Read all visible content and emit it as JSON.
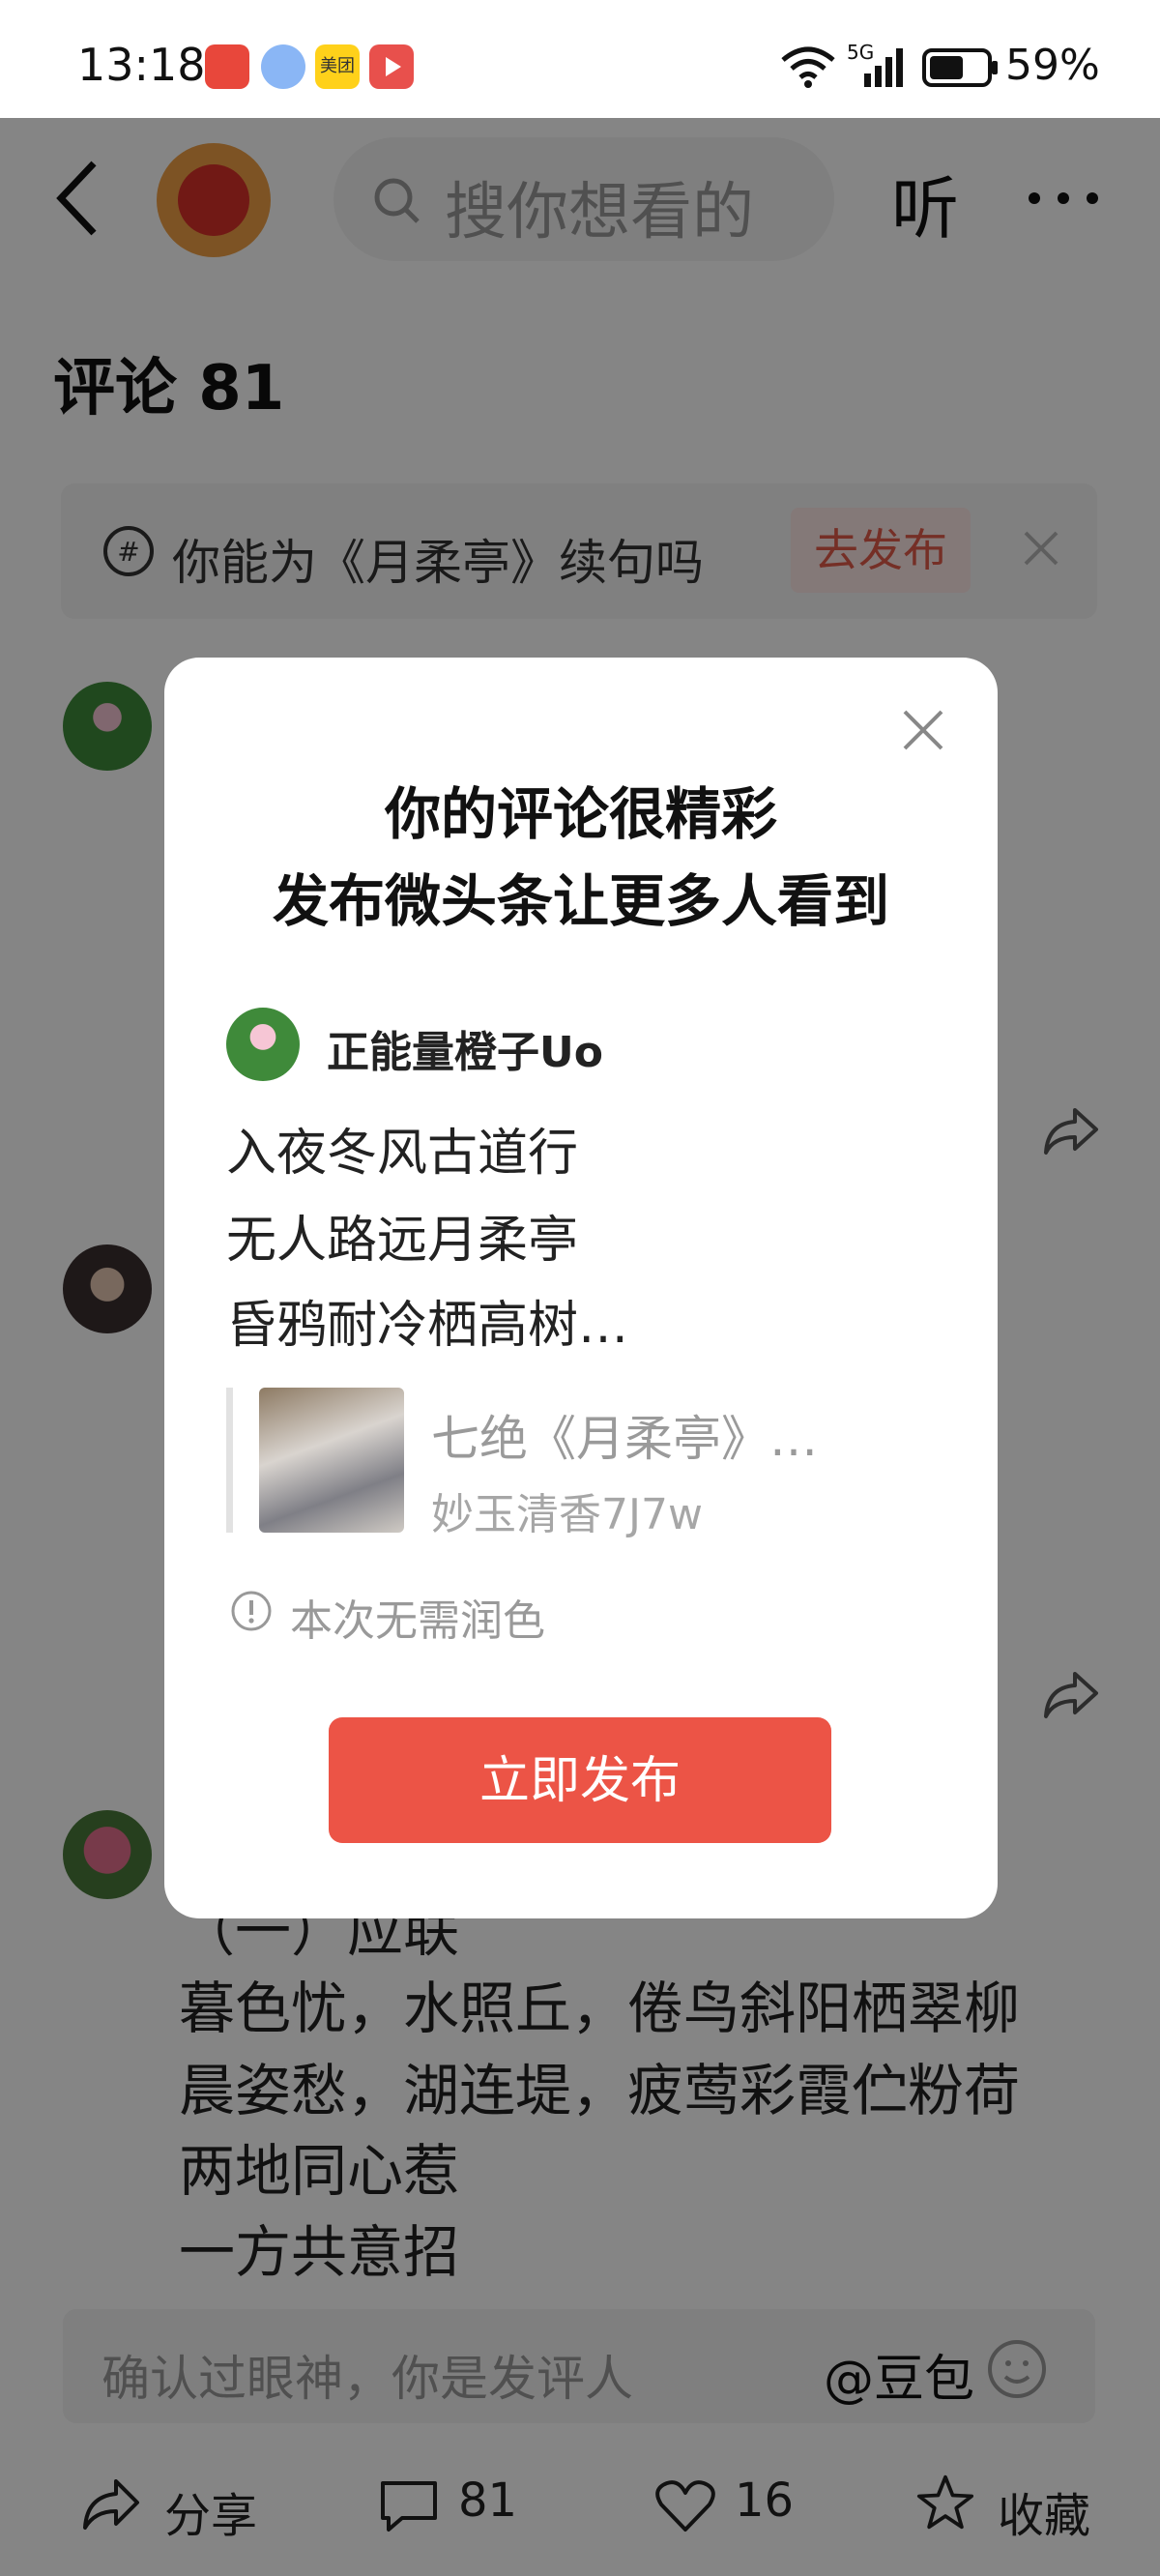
{
  "status": {
    "time": "13:18",
    "apps": [
      {
        "name": "618-app-icon",
        "color": "#e8473b"
      },
      {
        "name": "mascot-app-icon",
        "color": "#8ab6f5"
      },
      {
        "name": "meituan-icon",
        "color": "#ffd11a",
        "label": "美团"
      },
      {
        "name": "video-app-icon",
        "color": "#e8504c"
      }
    ],
    "network": "5G",
    "battery": "59%"
  },
  "header": {
    "search_placeholder": "搜你想看的",
    "listen_label": "听"
  },
  "comments_title": "评论 81",
  "prompt": {
    "text": "你能为《月柔亭》续句吗",
    "button": "去发布"
  },
  "background_comment": {
    "lines": [
      "（一）应联",
      "暮色忧，水照丘，倦鸟斜阳栖翠柳",
      "晨姿愁，湖连堤，疲莺彩霞伫粉荷",
      "两地同心惹",
      "一方共意招"
    ]
  },
  "input": {
    "placeholder": "确认过眼神，你是发评人",
    "mention": "@豆包"
  },
  "bottom_bar": {
    "share": "分享",
    "comments": "81",
    "likes": "16",
    "favorite": "收藏"
  },
  "modal": {
    "title_line1": "你的评论很精彩",
    "title_line2": "发布微头条让更多人看到",
    "username": "正能量橙子Uo",
    "lines": [
      "入夜冬风古道行",
      "无人路远月柔亭",
      "昏鸦耐冷栖高树…"
    ],
    "quote_title": "七绝《月柔亭》…",
    "quote_author": "妙玉清香7J7w",
    "info": "本次无需润色",
    "publish_button": "立即发布"
  },
  "colors": {
    "accent": "#ec5446",
    "overlay": "rgba(0,0,0,0.48)"
  }
}
